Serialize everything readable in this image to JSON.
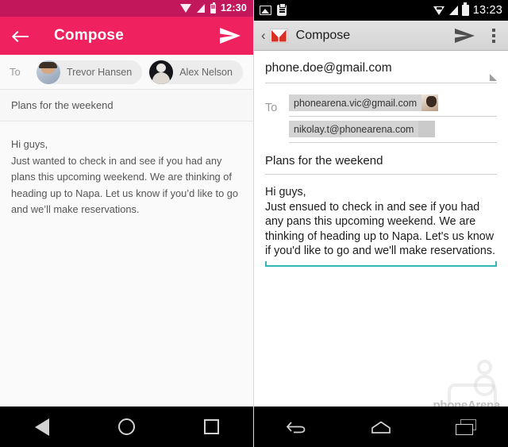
{
  "left": {
    "platform_label": "material-compose",
    "status_bar": {
      "clock": "12:30",
      "icons": [
        "wifi-icon",
        "signal-icon",
        "battery-icon"
      ],
      "background": "#C2185B"
    },
    "app_bar": {
      "background": "#F0215F",
      "back_label": "Back",
      "title": "Compose",
      "send_label": "Send"
    },
    "to_field": {
      "label": "To",
      "recipients": [
        {
          "name": "Trevor Hansen",
          "avatar": "photo-light"
        },
        {
          "name": "Alex Nelson",
          "avatar": "photo-dark"
        }
      ]
    },
    "subject": "Plans for the weekend",
    "body": "Hi guys,\nJust wanted to check in and see if you had any plans this upcoming weekend. We are thinking of heading up to Napa. Let us know if you’d like to go and we’ll make reservations.",
    "nav_bar": {
      "back": "back-triangle-icon",
      "home": "home-circle-icon",
      "recents": "recents-square-icon"
    }
  },
  "right": {
    "platform_label": "holo-compose",
    "status_bar": {
      "clock": "13:23",
      "left_icons": [
        "image-icon",
        "clipboard-icon"
      ],
      "right_icons": [
        "wifi-icon",
        "signal-icon",
        "battery-icon"
      ],
      "background": "#000000"
    },
    "action_bar": {
      "back_label": "‹",
      "app_icon": "gmail-logo-icon",
      "title": "Compose",
      "send_label": "Send",
      "overflow_label": "More options"
    },
    "from_field": {
      "value": "phone.doe@gmail.com",
      "dropdown": "dropdown-corner-icon"
    },
    "to_field": {
      "label": "To",
      "recipients": [
        {
          "address": "phonearena.vic@gmail.com",
          "thumb": "photo"
        },
        {
          "address": "nikolay.t@phonearena.com",
          "thumb": "blank"
        }
      ]
    },
    "subject": "Plans for the weekend",
    "body": "Hi guys,\nJust ensued to check in and see if you had any pans this upcoming weekend. We are thinking of heading up to Napa. Let's us know if you'd like to go and we'll make reservations.",
    "accent_color": "#33B5B5",
    "nav_bar": {
      "back": "back-arrow-icon",
      "home": "home-icon",
      "recents": "recents-icon"
    },
    "watermark": "phoneArena"
  }
}
